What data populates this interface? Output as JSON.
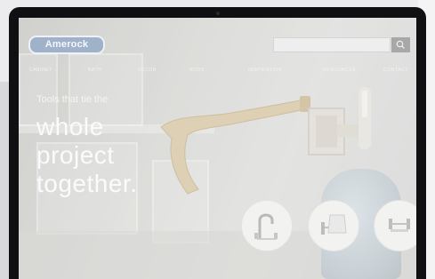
{
  "header": {
    "logo_text": "Amerock",
    "search": {
      "placeholder": ""
    }
  },
  "nav": {
    "items": [
      {
        "label": "CABINET"
      },
      {
        "label": "BATH"
      },
      {
        "label": "DECOR"
      },
      {
        "label": "RODS"
      },
      {
        "label": "INSPIRATION"
      },
      {
        "label": "RESOURCES"
      },
      {
        "label": "CONTACT"
      }
    ]
  },
  "hero": {
    "tagline": "Tools that tie the",
    "lines": [
      "whole",
      "project",
      "together."
    ]
  },
  "product_circles": [
    {
      "icon": "faucet-icon"
    },
    {
      "icon": "sconce-icon"
    },
    {
      "icon": "towel-bar-icon"
    }
  ],
  "colors": {
    "logo_bg": "#9fb2c9",
    "handle_brass": "#d9c6a1",
    "hero_text": "#fbfbfb",
    "device_bezel": "#101012"
  }
}
